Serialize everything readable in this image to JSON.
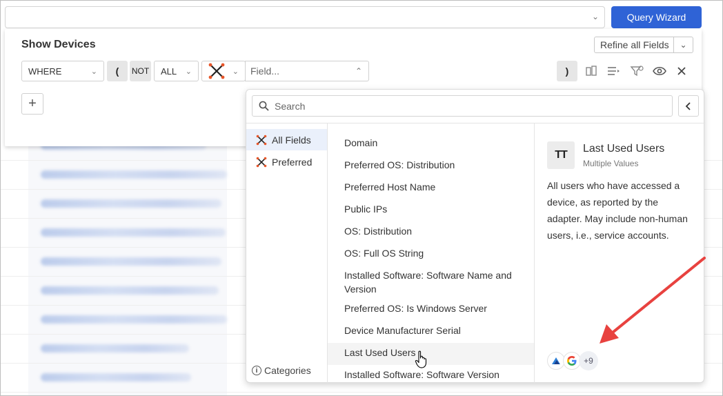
{
  "topbar": {
    "query_wizard_label": "Query Wizard"
  },
  "panel": {
    "title": "Show Devices",
    "refine_label": "Refine all Fields",
    "where_label": "WHERE",
    "open_paren": "(",
    "not_label": "NOT",
    "all_label": "ALL",
    "field_placeholder": "Field...",
    "close_paren": ")",
    "add_label": "+"
  },
  "dropdown": {
    "search_placeholder": "Search",
    "categories": [
      {
        "label": "All Fields",
        "active": true
      },
      {
        "label": "Preferred",
        "active": false
      }
    ],
    "categories_footer": "Categories",
    "fields": [
      "Domain",
      "Preferred OS: Distribution",
      "Preferred Host Name",
      "Public IPs",
      "OS: Distribution",
      "OS: Full OS String",
      "Installed Software: Software Name and Version",
      "Preferred OS: Is Windows Server",
      "Device Manufacturer Serial",
      "Last Used Users",
      "Installed Software: Software Version"
    ],
    "hovered_field": "Last Used Users",
    "detail": {
      "type_badge": "TT",
      "title": "Last Used Users",
      "subtitle": "Multiple Values",
      "description": "All users who have accessed a device, as reported by the adapter. May include non-human users, i.e., service accounts.",
      "adapters": [
        "azure-icon",
        "google-icon"
      ],
      "more_adapters": "+9"
    }
  },
  "colors": {
    "accent": "#2f63d6",
    "annotation_arrow": "#e8423f",
    "logo_orange": "#e8562a"
  }
}
